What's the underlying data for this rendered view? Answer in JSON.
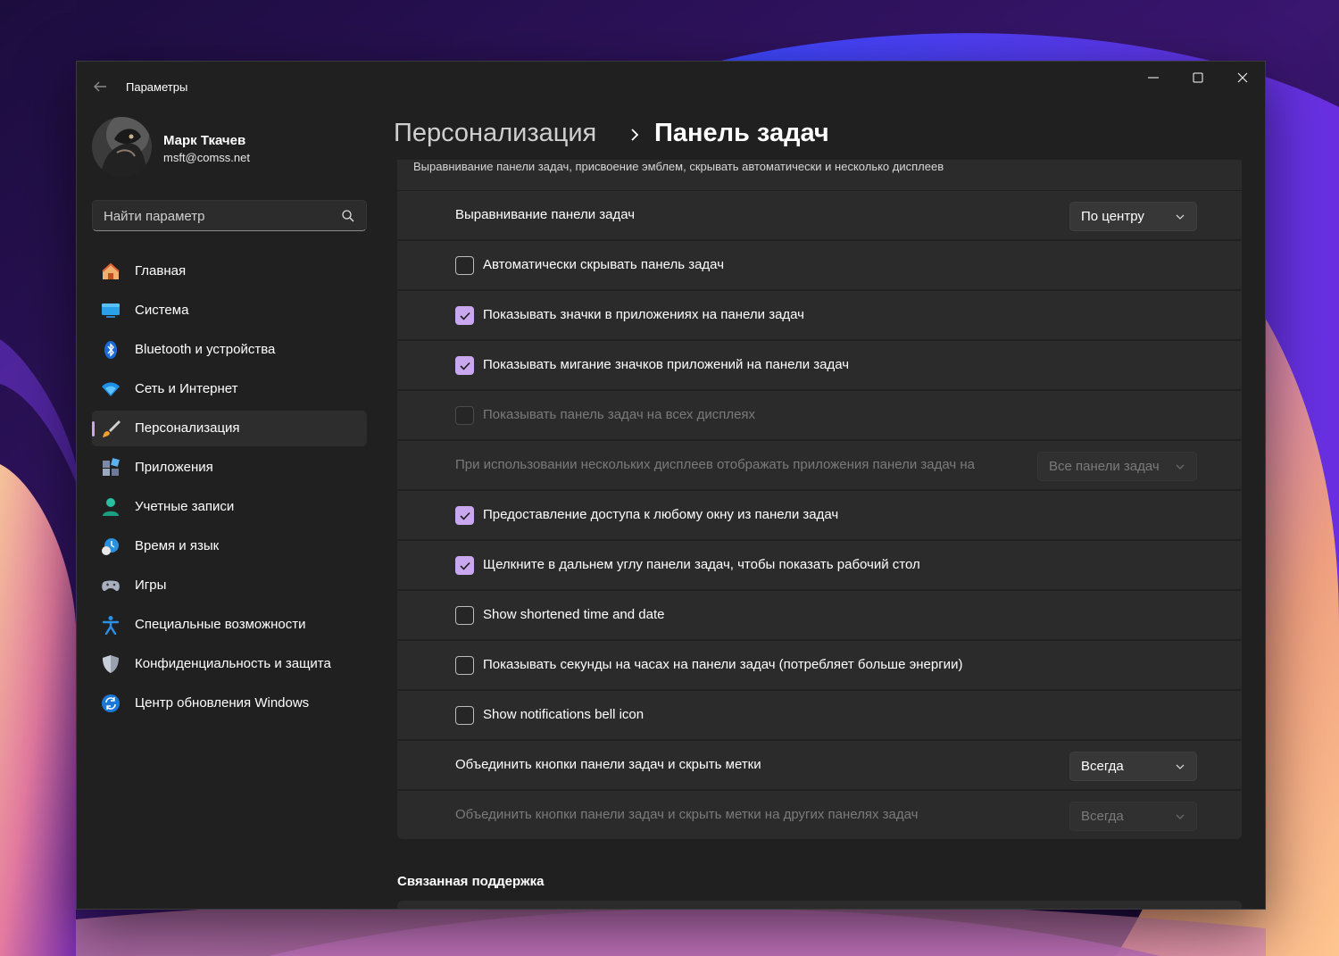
{
  "window": {
    "app_title": "Параметры",
    "accent_color": "#c9a8f0"
  },
  "user": {
    "name": "Марк Ткачев",
    "email": "msft@comss.net"
  },
  "search": {
    "placeholder": "Найти параметр"
  },
  "sidebar": {
    "items": [
      {
        "label": "Главная",
        "icon": "home-icon"
      },
      {
        "label": "Система",
        "icon": "system-icon"
      },
      {
        "label": "Bluetooth и устройства",
        "icon": "bluetooth-icon"
      },
      {
        "label": "Сеть и Интернет",
        "icon": "wifi-icon"
      },
      {
        "label": "Персонализация",
        "icon": "brush-icon",
        "selected": true
      },
      {
        "label": "Приложения",
        "icon": "apps-icon"
      },
      {
        "label": "Учетные записи",
        "icon": "account-icon"
      },
      {
        "label": "Время и язык",
        "icon": "time-language-icon"
      },
      {
        "label": "Игры",
        "icon": "gamepad-icon"
      },
      {
        "label": "Специальные возможности",
        "icon": "accessibility-icon"
      },
      {
        "label": "Конфиденциальность и защита",
        "icon": "shield-icon"
      },
      {
        "label": "Центр обновления Windows",
        "icon": "update-icon"
      }
    ]
  },
  "header": {
    "parent": "Персонализация",
    "current": "Панель задач"
  },
  "behaviors": {
    "description": "Выравнивание панели задач, присвоение эмблем, скрывать автоматически и несколько дисплеев",
    "alignment": {
      "label": "Выравнивание панели задач",
      "value": "По центру"
    },
    "auto_hide": {
      "label": "Автоматически скрывать панель задач",
      "checked": false
    },
    "show_badges": {
      "label": "Показывать значки в приложениях на панели задач",
      "checked": true
    },
    "show_flashing": {
      "label": "Показывать мигание значков приложений на панели задач",
      "checked": true
    },
    "all_displays": {
      "label": "Показывать панель задач на всех дисплеях",
      "checked": false,
      "disabled": true
    },
    "multi_display": {
      "label": "При использовании нескольких дисплеев отображать приложения панели задач на",
      "value": "Все панели задач",
      "disabled": true
    },
    "share_window": {
      "label": "Предоставление доступа к любому окну из панели задач",
      "checked": true
    },
    "corner_desktop": {
      "label": "Щелкните в дальнем углу панели задач, чтобы показать рабочий стол",
      "checked": true
    },
    "short_time": {
      "label": "Show shortened time and date",
      "checked": false
    },
    "seconds": {
      "label": "Показывать секунды на часах на панели задач (потребляет больше энергии)",
      "checked": false
    },
    "bell_icon": {
      "label": "Show notifications bell icon",
      "checked": false
    },
    "combine": {
      "label": "Объединить кнопки панели задач и скрыть метки",
      "value": "Всегда"
    },
    "combine_other": {
      "label": "Объединить кнопки панели задач и скрыть метки на других панелях задач",
      "value": "Всегда",
      "disabled": true
    }
  },
  "related": {
    "title": "Связанная поддержка"
  }
}
